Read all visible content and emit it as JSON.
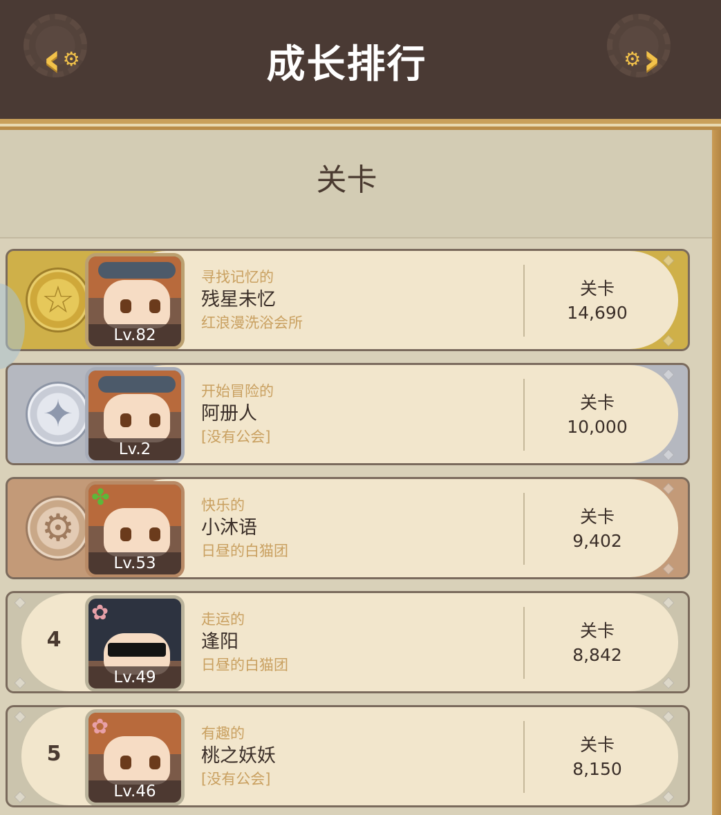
{
  "header": {
    "title": "成长排行",
    "back_icon": "chevron-left-gear-icon",
    "forward_icon": "chevron-right-gear-icon"
  },
  "section": {
    "title": "关卡"
  },
  "rankings": [
    {
      "rank": "1",
      "medal": "gold-star-medal",
      "level": "Lv.82",
      "epithet": "寻找记忆的",
      "name": "残星未忆",
      "guild": "红浪漫洗浴会所",
      "score_label": "关卡",
      "score": "14,690"
    },
    {
      "rank": "2",
      "medal": "silver-compass-medal",
      "level": "Lv.2",
      "epithet": "开始冒险的",
      "name": "阿册人",
      "guild": "[没有公会]",
      "score_label": "关卡",
      "score": "10,000"
    },
    {
      "rank": "3",
      "medal": "bronze-gear-medal",
      "level": "Lv.53",
      "epithet": "快乐的",
      "name": "小沐语",
      "guild": "日昼的白猫团",
      "score_label": "关卡",
      "score": "9,402"
    },
    {
      "rank": "4",
      "medal": "",
      "level": "Lv.49",
      "epithet": "走运的",
      "name": "逢阳",
      "guild": "日昼的白猫团",
      "score_label": "关卡",
      "score": "8,842"
    },
    {
      "rank": "5",
      "medal": "",
      "level": "Lv.46",
      "epithet": "有趣的",
      "name": "桃之妖妖",
      "guild": "[没有公会]",
      "score_label": "关卡",
      "score": "8,150"
    }
  ],
  "colors": {
    "header_bg": "#4a3a34",
    "gold": "#cfb049",
    "silver": "#b5b8c0",
    "bronze": "#c39a78",
    "epithet_text": "#c9a060",
    "accent_yellow": "#f2c24a"
  }
}
